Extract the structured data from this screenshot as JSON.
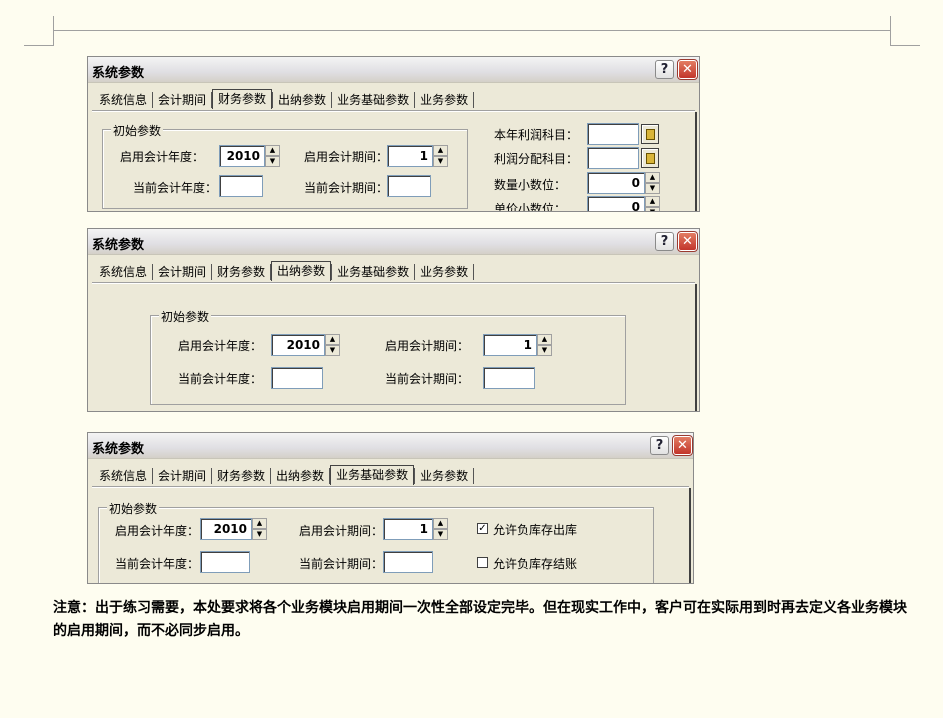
{
  "dialogs": [
    {
      "title": "系统参数",
      "help_label": "?",
      "close_label": "✕",
      "tabs": [
        "系统信息",
        "会计期间",
        "财务参数",
        "出纳参数",
        "业务基础参数",
        "业务参数"
      ],
      "active_tab": "财务参数",
      "group_label": "初始参数",
      "start_year_label": "启用会计年度：",
      "start_year": "2010",
      "start_period_label": "启用会计期间：",
      "start_period": "1",
      "current_year_label": "当前会计年度：",
      "current_year": "",
      "current_period_label": "当前会计期间：",
      "current_period": "",
      "profit_account_label": "本年利润科目：",
      "profit_account": "",
      "dist_account_label": "利润分配科目：",
      "dist_account": "",
      "qty_decimals_label": "数量小数位：",
      "qty_decimals": "0",
      "price_decimals_label": "单价小数位：",
      "price_decimals": "0"
    },
    {
      "title": "系统参数",
      "help_label": "?",
      "close_label": "✕",
      "tabs": [
        "系统信息",
        "会计期间",
        "财务参数",
        "出纳参数",
        "业务基础参数",
        "业务参数"
      ],
      "active_tab": "出纳参数",
      "group_label": "初始参数",
      "start_year_label": "启用会计年度：",
      "start_year": "2010",
      "start_period_label": "启用会计期间：",
      "start_period": "1",
      "current_year_label": "当前会计年度：",
      "current_year": "",
      "current_period_label": "当前会计期间：",
      "current_period": ""
    },
    {
      "title": "系统参数",
      "help_label": "?",
      "close_label": "✕",
      "tabs": [
        "系统信息",
        "会计期间",
        "财务参数",
        "出纳参数",
        "业务基础参数",
        "业务参数"
      ],
      "active_tab": "业务基础参数",
      "group_label": "初始参数",
      "start_year_label": "启用会计年度：",
      "start_year": "2010",
      "start_period_label": "启用会计期间：",
      "start_period": "1",
      "current_year_label": "当前会计年度：",
      "current_year": "",
      "current_period_label": "当前会计期间：",
      "current_period": "",
      "allow_neg_out_label": "允许负库存出库",
      "allow_neg_out": true,
      "allow_neg_close_label": "允许负库存结账",
      "allow_neg_close": false
    }
  ],
  "note": "注意：出于练习需要，本处要求将各个业务模块启用期间一次性全部设定完毕。但在现实工作中，客户可在实际用到时再去定义各业务模块的启用期间，而不必同步启用。",
  "colors": {
    "page_bg": "#FEFDF0",
    "dialog_bg": "#ECE9D8",
    "close_red": "#C2352B"
  }
}
